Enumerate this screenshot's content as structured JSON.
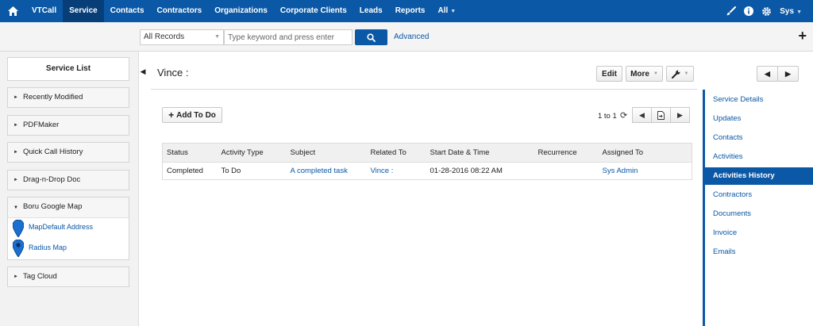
{
  "topnav": {
    "items": [
      "VTCall",
      "Service",
      "Contacts",
      "Contractors",
      "Organizations",
      "Corporate Clients",
      "Leads",
      "Reports",
      "All"
    ],
    "active": "Service",
    "user": "Sys"
  },
  "search": {
    "filter_value": "All Records",
    "placeholder": "Type keyword and press enter",
    "advanced_label": "Advanced"
  },
  "sidebar": {
    "title": "Service List",
    "items": [
      "Recently Modified",
      "PDFMaker",
      "Quick Call History",
      "Drag-n-Drop Doc"
    ],
    "map_panel": {
      "label": "Boru Google Map",
      "links": [
        "MapDefault Address",
        "Radius Map"
      ]
    },
    "tag_cloud": "Tag Cloud"
  },
  "record": {
    "title": "Vince :",
    "edit_label": "Edit",
    "more_label": "More"
  },
  "activities": {
    "add_todo_label": "Add To Do",
    "pager": "1 to 1",
    "columns": [
      "Status",
      "Activity Type",
      "Subject",
      "Related To",
      "Start Date & Time",
      "Recurrence",
      "Assigned To"
    ],
    "rows": [
      {
        "status": "Completed",
        "type": "To Do",
        "subject": "A completed task",
        "related": "Vince :",
        "start": "01-28-2016 08:22 AM",
        "recurrence": "",
        "assigned": "Sys Admin"
      }
    ]
  },
  "right_tabs": {
    "items": [
      "Service Details",
      "Updates",
      "Contacts",
      "Activities",
      "Activities History",
      "Contractors",
      "Documents",
      "Invoice",
      "Emails"
    ],
    "active": "Activities History"
  },
  "colors": {
    "brand": "#0b58a6",
    "nav_active": "#083e78"
  }
}
